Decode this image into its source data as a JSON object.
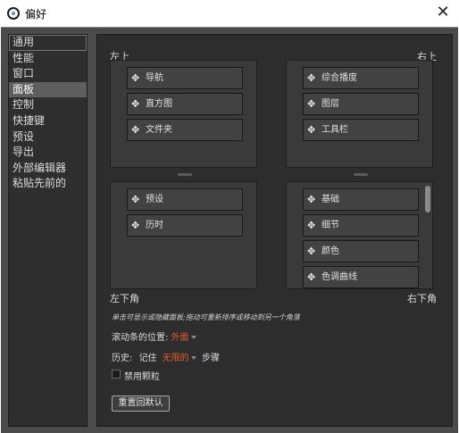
{
  "window": {
    "title": "偏好",
    "close_glyph": "✕"
  },
  "sidebar": {
    "items": [
      {
        "label": "通用"
      },
      {
        "label": "性能"
      },
      {
        "label": "窗口"
      },
      {
        "label": "面板"
      },
      {
        "label": "控制"
      },
      {
        "label": "快捷键"
      },
      {
        "label": "预设"
      },
      {
        "label": "导出"
      },
      {
        "label": "外部编辑器"
      },
      {
        "label": "粘贴先前的"
      }
    ],
    "selected": "面板"
  },
  "panels": {
    "corners": {
      "top_left": "左上",
      "top_right": "右上",
      "bottom_left": "左下角",
      "bottom_right": "右下角"
    },
    "top_left": [
      {
        "label": "导航"
      },
      {
        "label": "直方图"
      },
      {
        "label": "文件夹"
      }
    ],
    "top_right": [
      {
        "label": "综合播度"
      },
      {
        "label": "图层"
      },
      {
        "label": "工具栏"
      }
    ],
    "bottom_left": [
      {
        "label": "预设"
      },
      {
        "label": "历时"
      }
    ],
    "bottom_right": [
      {
        "label": "基础"
      },
      {
        "label": "细节"
      },
      {
        "label": "颜色"
      },
      {
        "label": "色调曲线"
      }
    ],
    "move_icon": "move-icon"
  },
  "hint": "单击可显示或隐藏面板;拖动可重新排序或移动到另一个角落",
  "scroll_position": {
    "label": "滚动条的位置:",
    "value": "外面"
  },
  "history": {
    "label": "历史:",
    "remember": "记住",
    "value": "无限的",
    "unit": "步骤"
  },
  "disable_particles": {
    "label": "禁用颗粒",
    "checked": false
  },
  "reset_button": "重置回默认",
  "colors": {
    "accent": "#e25d2c",
    "panel_bg": "#4b4b4b",
    "content_bg": "#2d2d2d"
  }
}
